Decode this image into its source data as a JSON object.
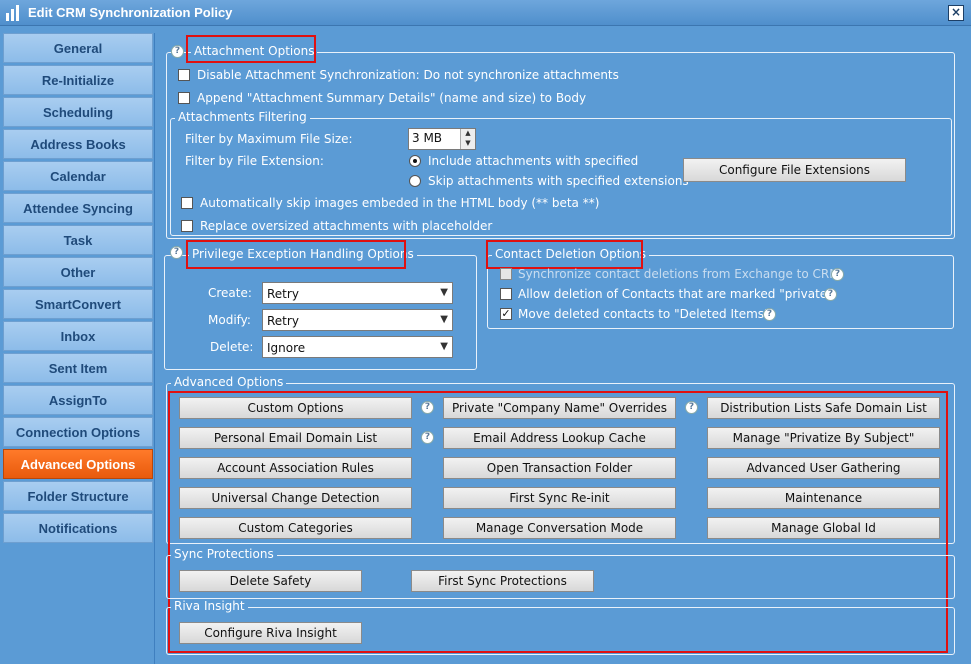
{
  "window": {
    "title": "Edit CRM Synchronization Policy"
  },
  "sidebar": {
    "items": [
      {
        "label": "General"
      },
      {
        "label": "Re-Initialize"
      },
      {
        "label": "Scheduling"
      },
      {
        "label": "Address Books"
      },
      {
        "label": "Calendar"
      },
      {
        "label": "Attendee Syncing"
      },
      {
        "label": "Task"
      },
      {
        "label": "Other"
      },
      {
        "label": "SmartConvert"
      },
      {
        "label": "Inbox"
      },
      {
        "label": "Sent Item"
      },
      {
        "label": "AssignTo"
      },
      {
        "label": "Connection Options"
      },
      {
        "label": "Advanced Options",
        "active": true
      },
      {
        "label": "Folder Structure"
      },
      {
        "label": "Notifications"
      }
    ]
  },
  "attachment_options": {
    "legend": "Attachment Options",
    "disable_sync": "Disable Attachment Synchronization: Do not synchronize attachments",
    "append_summary": "Append \"Attachment Summary Details\" (name and size) to Body",
    "filtering": {
      "legend": "Attachments Filtering",
      "max_size_label": "Filter by Maximum File Size:",
      "max_size_value": "3 MB",
      "extension_label": "Filter by File Extension:",
      "include_label": "Include attachments with specified",
      "skip_label": "Skip attachments with specified extensions",
      "configure_button": "Configure File Extensions",
      "skip_images": "Automatically skip images embeded in the HTML body (** beta **)",
      "replace_oversized": "Replace oversized attachments with placeholder"
    }
  },
  "privilege": {
    "legend": "Privilege Exception Handling Options",
    "create_label": "Create:",
    "create_value": "Retry",
    "modify_label": "Modify:",
    "modify_value": "Retry",
    "delete_label": "Delete:",
    "delete_value": "Ignore"
  },
  "contact_deletion": {
    "legend": "Contact Deletion Options",
    "sync_deletions": "Synchronize contact deletions from Exchange to CRM",
    "allow_private": "Allow deletion of Contacts that are marked \"private\"",
    "move_deleted": "Move deleted contacts to \"Deleted Items\""
  },
  "advanced": {
    "legend": "Advanced Options",
    "buttons": {
      "custom_options": "Custom Options",
      "private_company": "Private \"Company Name\" Overrides",
      "distribution_lists": "Distribution Lists Safe Domain List",
      "personal_email": "Personal Email Domain List",
      "email_lookup": "Email Address Lookup Cache",
      "privatize_subject": "Manage \"Privatize By Subject\"",
      "account_association": "Account Association Rules",
      "open_transaction": "Open Transaction Folder",
      "advanced_user": "Advanced User Gathering",
      "universal_change": "Universal Change Detection",
      "first_sync_reinit": "First Sync Re-init",
      "maintenance": "Maintenance",
      "custom_categories": "Custom Categories",
      "conversation_mode": "Manage Conversation Mode",
      "global_id": "Manage Global Id"
    }
  },
  "sync_protections": {
    "legend": "Sync Protections",
    "delete_safety": "Delete Safety",
    "first_sync": "First Sync Protections"
  },
  "riva_insight": {
    "legend": "Riva Insight",
    "configure": "Configure Riva Insight"
  },
  "colors": {
    "accent_active": "#e85a0c",
    "highlight": "#e01010",
    "background": "#5b9bd5"
  }
}
